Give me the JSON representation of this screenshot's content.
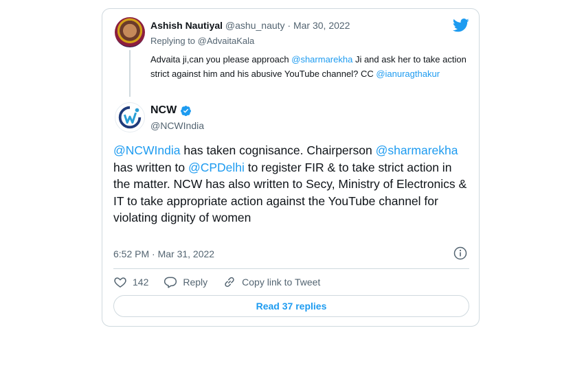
{
  "reply_tweet": {
    "name": "Ashish Nautiyal",
    "handle_meta": "@ashu_nauty · Mar 30, 2022",
    "replying_prefix": "Replying to ",
    "replying_to": "@AdvaitaKala",
    "text_1": "Advaita ji,can you please approach ",
    "mention_1": "@sharmarekha",
    "text_2": " Ji and ask her to take action strict against him and his abusive YouTube channel? CC ",
    "mention_2": "@ianuragthakur"
  },
  "main_tweet": {
    "name": "NCW",
    "handle": "@NCWIndia",
    "mention_1": "@NCWIndia",
    "text_1": " has taken cognisance. Chairperson ",
    "mention_2": "@sharmarekha",
    "text_2": " has written to ",
    "mention_3": "@CPDelhi",
    "text_3": " to register FIR & to take strict action in the matter. NCW has also written to Secy, Ministry of Electronics & IT to take appropriate action against the YouTube channel for violating dignity of women",
    "timestamp": "6:52 PM · Mar 31, 2022"
  },
  "actions": {
    "likes": "142",
    "reply_label": "Reply",
    "copy_label": "Copy link to Tweet"
  },
  "read_replies_label": "Read 37 replies",
  "colors": {
    "accent": "#1d9bf0",
    "text": "#0f1419",
    "muted": "#536471",
    "border": "#cfd9de"
  },
  "icons": [
    "twitter-bird-icon",
    "verified-badge-icon",
    "info-icon",
    "heart-icon",
    "reply-icon",
    "link-icon"
  ]
}
